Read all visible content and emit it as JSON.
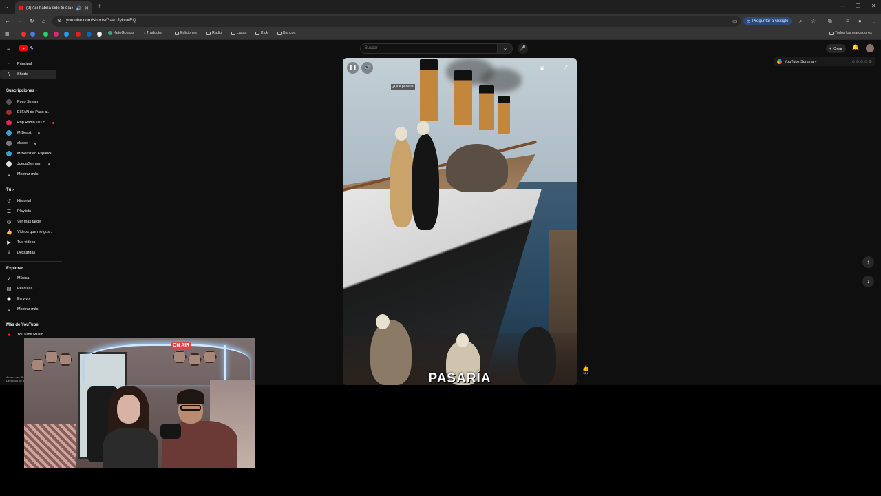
{
  "browser": {
    "tab_title": "(9) Así habría sido tu día en",
    "url": "youtube.com/shorts/Gae1JykoXEQ",
    "ask_google": "Preguntar a Google",
    "all_bookmarks": "Todos los marcadores",
    "bookmarks": [
      {
        "label": "KetoGo.app",
        "type": "site"
      },
      {
        "label": "Traductor",
        "type": "site"
      },
      {
        "label": "Ediciones",
        "type": "folder"
      },
      {
        "label": "Radio",
        "type": "folder"
      },
      {
        "label": "casas",
        "type": "folder"
      },
      {
        "label": "Kick",
        "type": "folder"
      },
      {
        "label": "Bancos",
        "type": "folder"
      }
    ]
  },
  "youtube": {
    "search_placeholder": "Buscar",
    "create_label": "Crear",
    "summary_label": "YouTube Summary",
    "sidebar": {
      "main": [
        {
          "label": "Principal",
          "icon": "home-icon"
        },
        {
          "label": "Shorts",
          "icon": "shorts-icon",
          "active": true
        }
      ],
      "subscriptions_title": "Suscripciones",
      "subscriptions": [
        {
          "label": "Poco Stream",
          "color": "#555555"
        },
        {
          "label": "El FAN de Paso a...",
          "color": "#a03030"
        },
        {
          "label": "Pop Radio 101.5",
          "color": "#e0245e"
        },
        {
          "label": "MrBeast",
          "color": "#3aa0d0"
        },
        {
          "label": "elrace",
          "color": "#7a7a7a"
        },
        {
          "label": "MrBeast en Español",
          "color": "#3aa0d0"
        },
        {
          "label": "JuegaGerman",
          "color": "#dddddd"
        },
        {
          "label": "Mostrar más",
          "color": ""
        }
      ],
      "you_title": "Tú",
      "you": [
        {
          "label": "Historial",
          "icon": "history-icon"
        },
        {
          "label": "Playlists",
          "icon": "playlist-icon"
        },
        {
          "label": "Ver más tarde",
          "icon": "clock-icon"
        },
        {
          "label": "Videos que me gus...",
          "icon": "like-icon"
        },
        {
          "label": "Tus videos",
          "icon": "video-icon"
        },
        {
          "label": "Descargas",
          "icon": "download-icon"
        }
      ],
      "explore_title": "Explorar",
      "explore": [
        {
          "label": "Música",
          "icon": "music-icon"
        },
        {
          "label": "Películas",
          "icon": "film-icon"
        },
        {
          "label": "En vivo",
          "icon": "live-icon"
        },
        {
          "label": "Mostrar más",
          "icon": "chevron-down-icon"
        }
      ],
      "more_title": "Más de YouTube",
      "more": [
        {
          "label": "YouTube Music"
        }
      ],
      "footer": "Acerca de · Prensa\nDerechos de autor"
    },
    "short": {
      "tag_text": "¿Qué pasaría",
      "caption": "PASARÍA",
      "like_count": "32 k"
    }
  },
  "webcam": {
    "on_air": "ON AIR"
  }
}
